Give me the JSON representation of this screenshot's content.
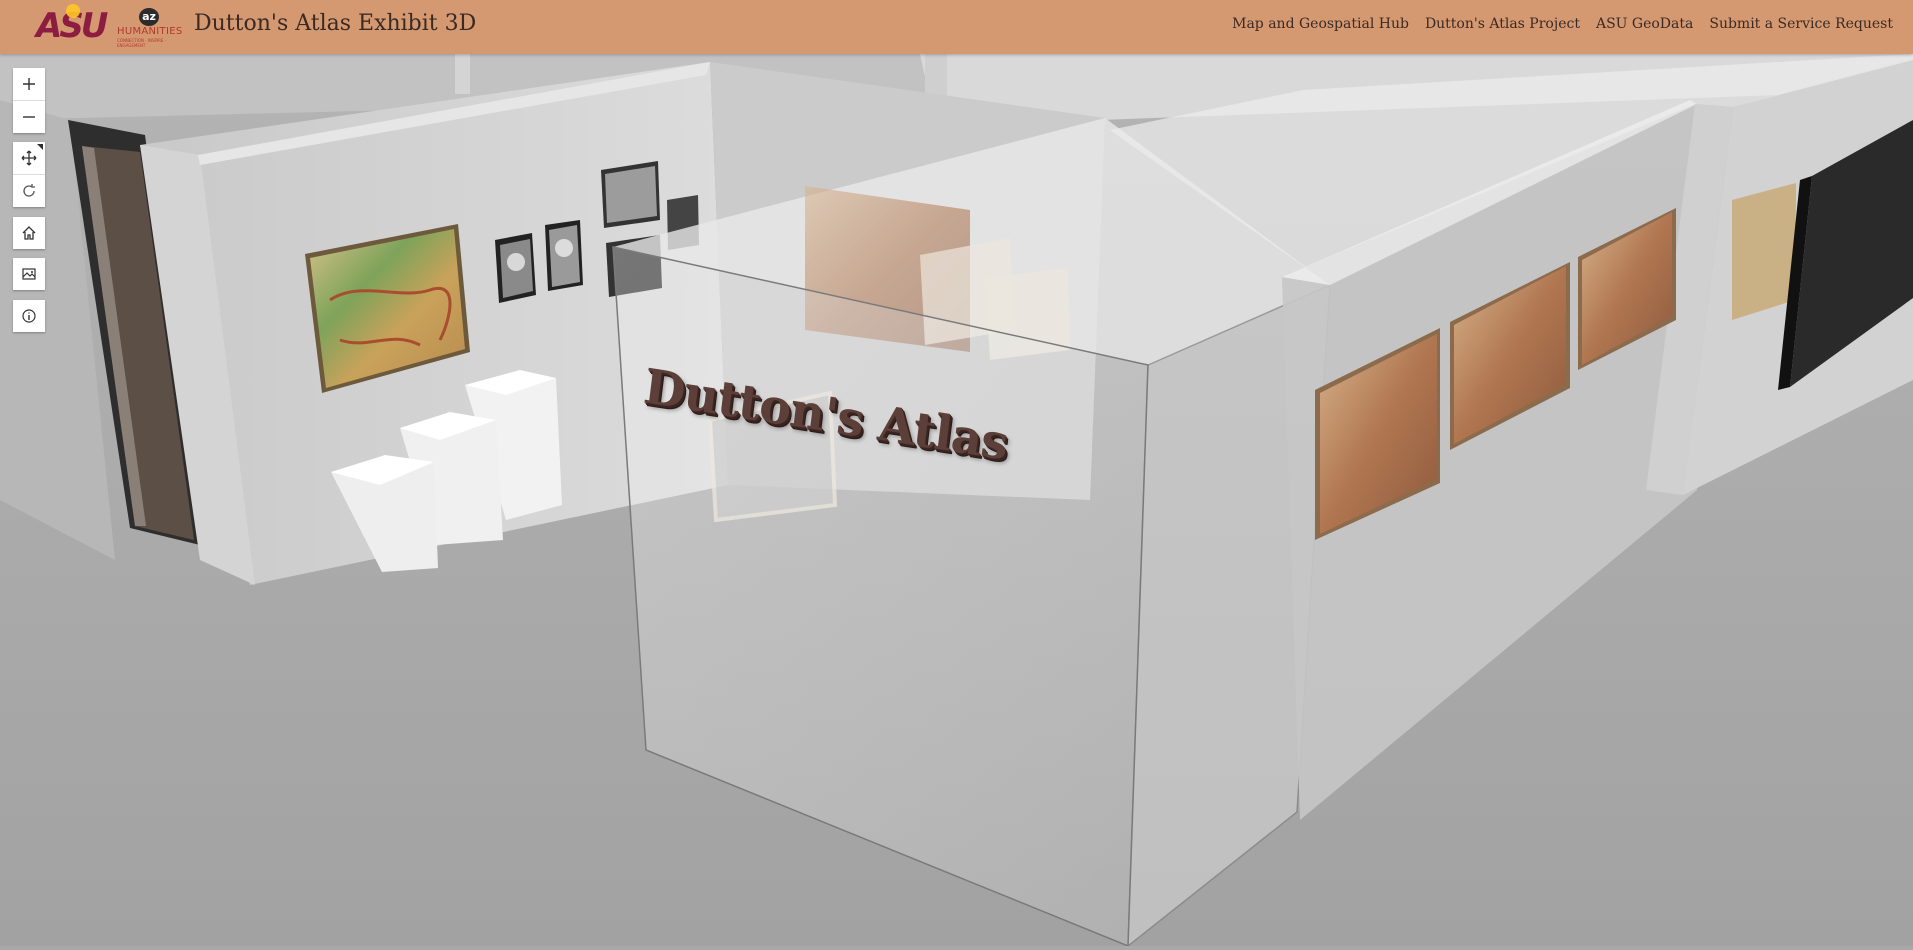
{
  "header": {
    "logo_asu": "ASU",
    "logo_az": "az",
    "logo_humanities": "HUMANITIES",
    "logo_tagline": "CONNECTION · INSPIRE · ENGAGEMENT",
    "title": "Dutton's Atlas Exhibit 3D",
    "nav": [
      {
        "label": "Map and Geospatial Hub"
      },
      {
        "label": "Dutton's Atlas Project"
      },
      {
        "label": "ASU GeoData"
      },
      {
        "label": "Submit a Service Request"
      }
    ]
  },
  "toolbar": {
    "zoom": [
      {
        "name": "zoom-in-icon",
        "title": "Zoom in"
      },
      {
        "name": "zoom-out-icon",
        "title": "Zoom out"
      }
    ],
    "navigation": [
      {
        "name": "pan-icon",
        "title": "Pan",
        "active": true
      },
      {
        "name": "rotate-icon",
        "title": "Rotate",
        "active": false
      }
    ],
    "home": {
      "name": "home-icon",
      "title": "Default map view"
    },
    "basemap": {
      "name": "basemap-gallery-icon",
      "title": "Basemap gallery"
    },
    "info": {
      "name": "info-icon",
      "title": "About"
    }
  },
  "scene": {
    "signage_text": "Dutton's Atlas"
  },
  "colors": {
    "header_bg": "#d59971",
    "asu_maroon": "#8c1d40",
    "asu_gold": "#ffc627",
    "title_text": "#3b2a24",
    "floor": "#a8a8a8",
    "wall": "#d6d6d6"
  }
}
